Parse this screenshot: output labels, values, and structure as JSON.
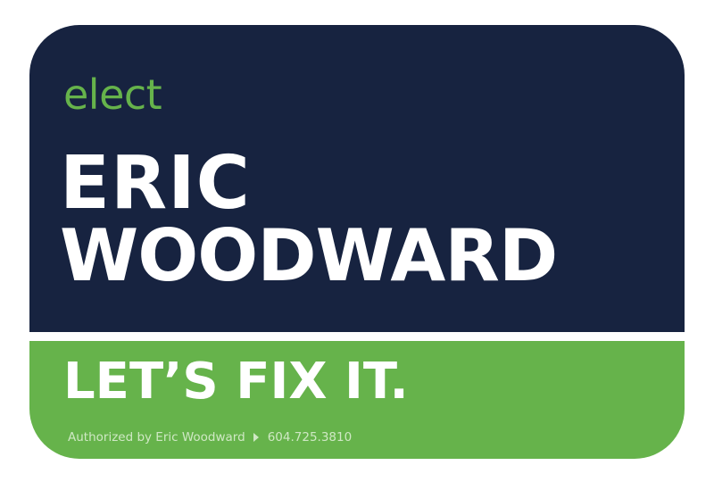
{
  "sign": {
    "elect_label": "elect",
    "first_name": "ERIC",
    "last_name": "WOODWARD",
    "slogan": "LET’S FIX IT.",
    "authorization_text": "Authorized by Eric Woodward",
    "phone": "604.725.3810",
    "separator_icon": "triangle-right-icon",
    "colors": {
      "navy": "#172340",
      "green": "#66b34b",
      "white": "#ffffff"
    }
  }
}
